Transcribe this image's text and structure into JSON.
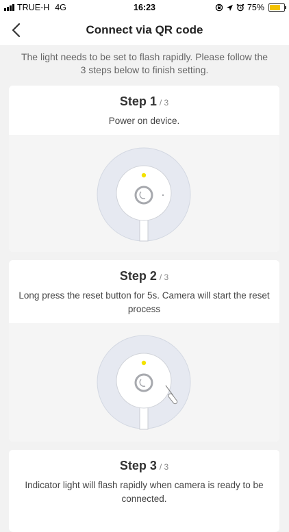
{
  "status_bar": {
    "carrier": "TRUE-H",
    "network": "4G",
    "time": "16:23",
    "battery_percent": "75%",
    "battery_level": 0.75,
    "icons": [
      "screen-rotation-lock-icon",
      "location-arrow-icon",
      "alarm-clock-icon"
    ]
  },
  "nav": {
    "back_icon": "chevron-left-icon",
    "title": "Connect via QR code"
  },
  "intro_text": "The light needs to be set to flash rapidly. Please follow the 3 steps below to finish setting.",
  "steps": [
    {
      "label": "Step 1",
      "total": "/ 3",
      "description": "Power on device."
    },
    {
      "label": "Step 2",
      "total": "/ 3",
      "description": "Long press the reset button for 5s. Camera will start the reset process"
    },
    {
      "label": "Step 3",
      "total": "/ 3",
      "description": "Indicator light will flash rapidly when camera is ready to be connected."
    }
  ],
  "colors": {
    "indicator_light": "#f3e200",
    "background": "#f2f2f2",
    "card": "#ffffff"
  }
}
